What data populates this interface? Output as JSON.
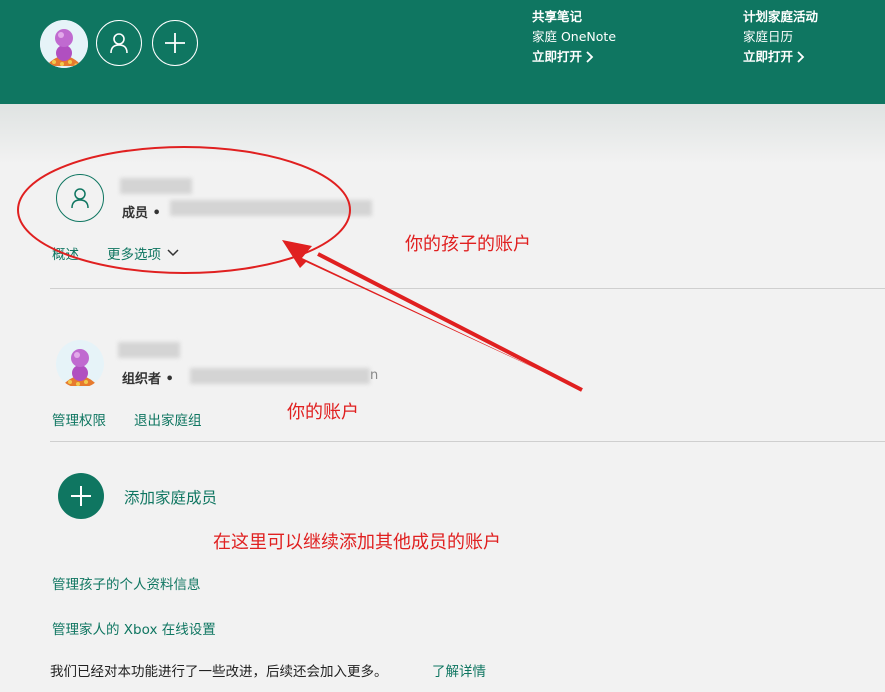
{
  "header": {
    "promos": [
      {
        "title": "共享笔记",
        "subtitle": "家庭 OneNote",
        "link": "立即打开"
      },
      {
        "title": "计划家庭活动",
        "subtitle": "家庭日历",
        "link": "立即打开"
      }
    ]
  },
  "members": [
    {
      "role": "成员 •",
      "links": [
        "概述",
        "更多选项"
      ]
    },
    {
      "role": "组织者 •",
      "email_tail": "n",
      "links": [
        "管理权限",
        "退出家庭组"
      ]
    }
  ],
  "add_member": {
    "label": "添加家庭成员"
  },
  "annotations": {
    "child": "你的孩子的账户",
    "you": "你的账户",
    "add": "在这里可以继续添加其他成员的账户"
  },
  "links": {
    "manage_child": "管理孩子的个人资料信息",
    "manage_xbox": "管理家人的 Xbox 在线设置"
  },
  "footer": {
    "text": "我们已经对本功能进行了一些改进，后续还会加入更多。",
    "link": "了解详情"
  },
  "colors": {
    "brand": "#0f7661",
    "annotation": "#e02020"
  }
}
